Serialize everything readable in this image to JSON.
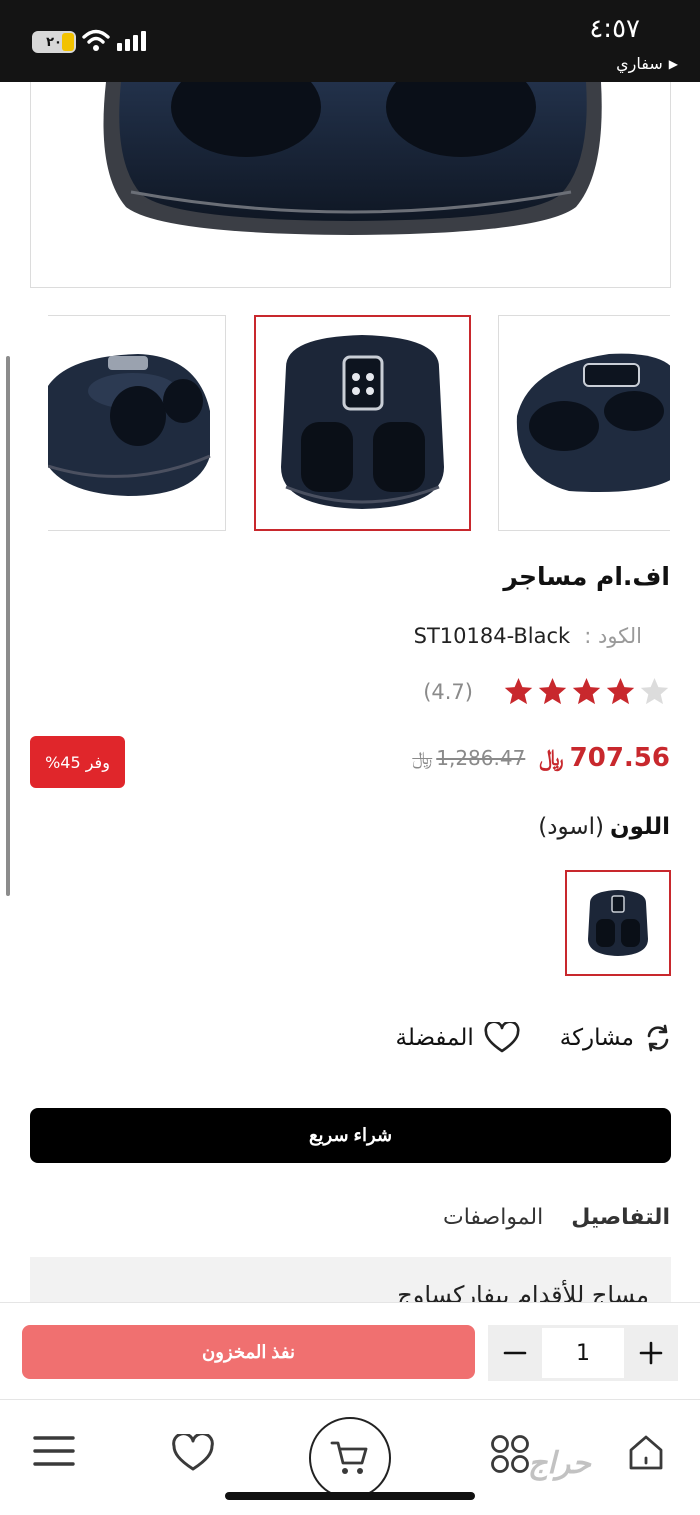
{
  "status_bar": {
    "time": "٤:٥٧",
    "back_app": "سفاري",
    "battery": "٢٠"
  },
  "product": {
    "title": "اف.ام مساجر",
    "code_label": "الكود :",
    "code_value": "ST10184-Black",
    "rating": "(4.7)",
    "rating_value": 4.7,
    "stars_filled": 4,
    "price": "707.56",
    "old_price": "1,286.47",
    "currency_symbol": "﷼",
    "discount": "وفر 45%",
    "color_label": "اللون",
    "color_value": "(اسود)"
  },
  "actions": {
    "share": "مشاركة",
    "favorite": "المفضلة"
  },
  "quick_buy": "شراء سريع",
  "tabs": [
    {
      "label": "التفاصيل",
      "active": true
    },
    {
      "label": "المواصفات",
      "active": false
    }
  ],
  "description_preview": "مساج للأقدام بيفاركساوج",
  "cart_bar": {
    "out_of_stock": "نفذ المخزون",
    "quantity": "1",
    "minus": "−",
    "plus": "+"
  },
  "bottom_nav": {
    "watermark": "حراج"
  },
  "colors": {
    "accent_red": "#c8282d",
    "discount_red": "#e0262b",
    "oos_button": "#f07070",
    "quick_buy": "#000000",
    "product_dark": "#1e2838"
  },
  "icons": [
    "wifi-icon",
    "signal-icon",
    "battery-icon",
    "star-icon",
    "refresh-icon",
    "heart-icon",
    "cart-icon",
    "menu-icon",
    "apps-icon",
    "home-icon",
    "minus-icon",
    "plus-icon"
  ]
}
